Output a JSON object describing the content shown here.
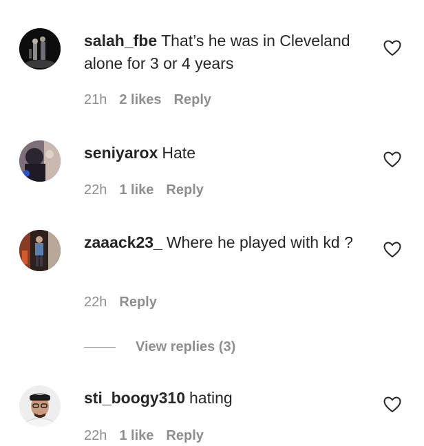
{
  "comments": [
    {
      "username": "salah_fbe",
      "text": "That’s he was in Cleveland alone for 3 or 4 years",
      "time": "21h",
      "likes": "2 likes",
      "reply": "Reply"
    },
    {
      "username": "seniyarox",
      "text": "Hate",
      "time": "22h",
      "likes": "1 like",
      "reply": "Reply"
    },
    {
      "username": "zaaack23_",
      "text": "Where he played with kd ?",
      "time": "22h",
      "reply": "Reply",
      "view_replies": "View replies (3)"
    },
    {
      "username": "sti_boogy310",
      "text": "hating",
      "time": "22h",
      "likes": "1 like",
      "reply": "Reply"
    }
  ],
  "icons": {
    "like": "heart-icon"
  },
  "colors": {
    "text": "#262626",
    "secondary": "#8e8e8e",
    "background": "#ffffff"
  }
}
